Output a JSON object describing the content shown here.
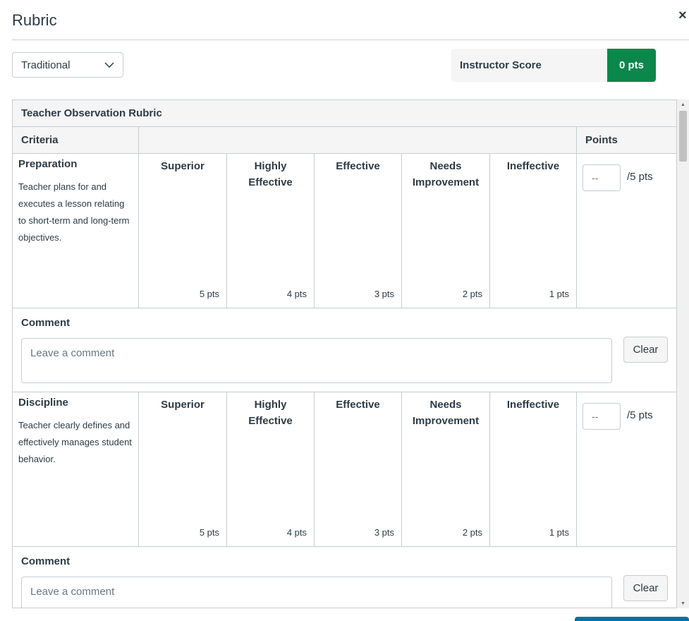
{
  "header": {
    "title": "Rubric",
    "close_glyph": "×"
  },
  "controls": {
    "view_select": {
      "value": "Traditional"
    },
    "score": {
      "label": "Instructor Score",
      "value": "0 pts",
      "color": "#0b874b"
    }
  },
  "rubric": {
    "title": "Teacher Observation Rubric",
    "columns": {
      "criteria": "Criteria",
      "points": "Points"
    },
    "criteria": [
      {
        "name": "Preparation",
        "description": "Teacher plans for and executes a lesson relating to short-term and long-term objectives.",
        "ratings": [
          {
            "name": "Superior",
            "points": "5 pts"
          },
          {
            "name": "Highly Effective",
            "points": "4 pts"
          },
          {
            "name": "Effective",
            "points": "3 pts"
          },
          {
            "name": "Needs Improvement",
            "points": "2 pts"
          },
          {
            "name": "Ineffective",
            "points": "1 pts"
          }
        ],
        "points_placeholder": "--",
        "points_max": "/5 pts",
        "comment": {
          "label": "Comment",
          "placeholder": "Leave a comment",
          "clear_label": "Clear"
        }
      },
      {
        "name": "Discipline",
        "description": "Teacher clearly defines and effectively manages student behavior.",
        "ratings": [
          {
            "name": "Superior",
            "points": "5 pts"
          },
          {
            "name": "Highly Effective",
            "points": "4 pts"
          },
          {
            "name": "Effective",
            "points": "3 pts"
          },
          {
            "name": "Needs Improvement",
            "points": "2 pts"
          },
          {
            "name": "Ineffective",
            "points": "1 pts"
          }
        ],
        "points_placeholder": "--",
        "points_max": "/5 pts",
        "comment": {
          "label": "Comment",
          "placeholder": "Leave a comment",
          "clear_label": "Clear"
        }
      }
    ]
  },
  "scrollbar": {
    "up_glyph": "▲",
    "down_glyph": "▼"
  }
}
